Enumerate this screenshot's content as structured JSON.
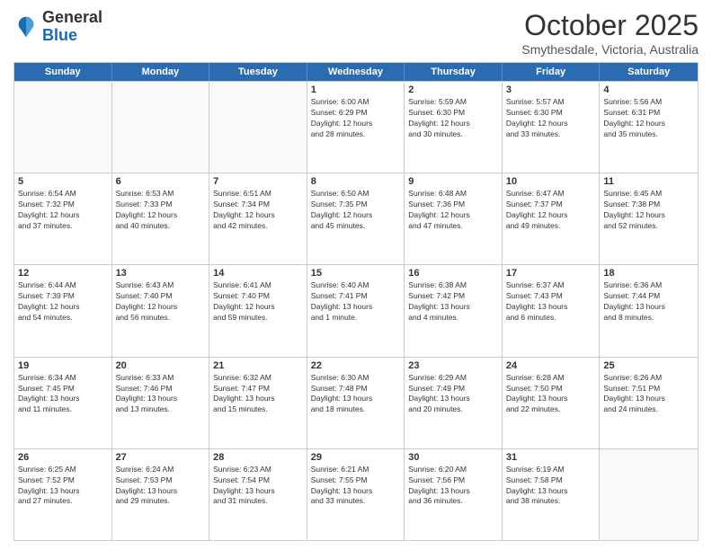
{
  "header": {
    "logo_general": "General",
    "logo_blue": "Blue",
    "month": "October 2025",
    "location": "Smythesdale, Victoria, Australia"
  },
  "weekdays": [
    "Sunday",
    "Monday",
    "Tuesday",
    "Wednesday",
    "Thursday",
    "Friday",
    "Saturday"
  ],
  "rows": [
    [
      {
        "day": "",
        "info": ""
      },
      {
        "day": "",
        "info": ""
      },
      {
        "day": "",
        "info": ""
      },
      {
        "day": "1",
        "info": "Sunrise: 6:00 AM\nSunset: 6:29 PM\nDaylight: 12 hours\nand 28 minutes."
      },
      {
        "day": "2",
        "info": "Sunrise: 5:59 AM\nSunset: 6:30 PM\nDaylight: 12 hours\nand 30 minutes."
      },
      {
        "day": "3",
        "info": "Sunrise: 5:57 AM\nSunset: 6:30 PM\nDaylight: 12 hours\nand 33 minutes."
      },
      {
        "day": "4",
        "info": "Sunrise: 5:56 AM\nSunset: 6:31 PM\nDaylight: 12 hours\nand 35 minutes."
      }
    ],
    [
      {
        "day": "5",
        "info": "Sunrise: 6:54 AM\nSunset: 7:32 PM\nDaylight: 12 hours\nand 37 minutes."
      },
      {
        "day": "6",
        "info": "Sunrise: 6:53 AM\nSunset: 7:33 PM\nDaylight: 12 hours\nand 40 minutes."
      },
      {
        "day": "7",
        "info": "Sunrise: 6:51 AM\nSunset: 7:34 PM\nDaylight: 12 hours\nand 42 minutes."
      },
      {
        "day": "8",
        "info": "Sunrise: 6:50 AM\nSunset: 7:35 PM\nDaylight: 12 hours\nand 45 minutes."
      },
      {
        "day": "9",
        "info": "Sunrise: 6:48 AM\nSunset: 7:36 PM\nDaylight: 12 hours\nand 47 minutes."
      },
      {
        "day": "10",
        "info": "Sunrise: 6:47 AM\nSunset: 7:37 PM\nDaylight: 12 hours\nand 49 minutes."
      },
      {
        "day": "11",
        "info": "Sunrise: 6:45 AM\nSunset: 7:38 PM\nDaylight: 12 hours\nand 52 minutes."
      }
    ],
    [
      {
        "day": "12",
        "info": "Sunrise: 6:44 AM\nSunset: 7:39 PM\nDaylight: 12 hours\nand 54 minutes."
      },
      {
        "day": "13",
        "info": "Sunrise: 6:43 AM\nSunset: 7:40 PM\nDaylight: 12 hours\nand 56 minutes."
      },
      {
        "day": "14",
        "info": "Sunrise: 6:41 AM\nSunset: 7:40 PM\nDaylight: 12 hours\nand 59 minutes."
      },
      {
        "day": "15",
        "info": "Sunrise: 6:40 AM\nSunset: 7:41 PM\nDaylight: 13 hours\nand 1 minute."
      },
      {
        "day": "16",
        "info": "Sunrise: 6:38 AM\nSunset: 7:42 PM\nDaylight: 13 hours\nand 4 minutes."
      },
      {
        "day": "17",
        "info": "Sunrise: 6:37 AM\nSunset: 7:43 PM\nDaylight: 13 hours\nand 6 minutes."
      },
      {
        "day": "18",
        "info": "Sunrise: 6:36 AM\nSunset: 7:44 PM\nDaylight: 13 hours\nand 8 minutes."
      }
    ],
    [
      {
        "day": "19",
        "info": "Sunrise: 6:34 AM\nSunset: 7:45 PM\nDaylight: 13 hours\nand 11 minutes."
      },
      {
        "day": "20",
        "info": "Sunrise: 6:33 AM\nSunset: 7:46 PM\nDaylight: 13 hours\nand 13 minutes."
      },
      {
        "day": "21",
        "info": "Sunrise: 6:32 AM\nSunset: 7:47 PM\nDaylight: 13 hours\nand 15 minutes."
      },
      {
        "day": "22",
        "info": "Sunrise: 6:30 AM\nSunset: 7:48 PM\nDaylight: 13 hours\nand 18 minutes."
      },
      {
        "day": "23",
        "info": "Sunrise: 6:29 AM\nSunset: 7:49 PM\nDaylight: 13 hours\nand 20 minutes."
      },
      {
        "day": "24",
        "info": "Sunrise: 6:28 AM\nSunset: 7:50 PM\nDaylight: 13 hours\nand 22 minutes."
      },
      {
        "day": "25",
        "info": "Sunrise: 6:26 AM\nSunset: 7:51 PM\nDaylight: 13 hours\nand 24 minutes."
      }
    ],
    [
      {
        "day": "26",
        "info": "Sunrise: 6:25 AM\nSunset: 7:52 PM\nDaylight: 13 hours\nand 27 minutes."
      },
      {
        "day": "27",
        "info": "Sunrise: 6:24 AM\nSunset: 7:53 PM\nDaylight: 13 hours\nand 29 minutes."
      },
      {
        "day": "28",
        "info": "Sunrise: 6:23 AM\nSunset: 7:54 PM\nDaylight: 13 hours\nand 31 minutes."
      },
      {
        "day": "29",
        "info": "Sunrise: 6:21 AM\nSunset: 7:55 PM\nDaylight: 13 hours\nand 33 minutes."
      },
      {
        "day": "30",
        "info": "Sunrise: 6:20 AM\nSunset: 7:56 PM\nDaylight: 13 hours\nand 36 minutes."
      },
      {
        "day": "31",
        "info": "Sunrise: 6:19 AM\nSunset: 7:58 PM\nDaylight: 13 hours\nand 38 minutes."
      },
      {
        "day": "",
        "info": ""
      }
    ]
  ]
}
